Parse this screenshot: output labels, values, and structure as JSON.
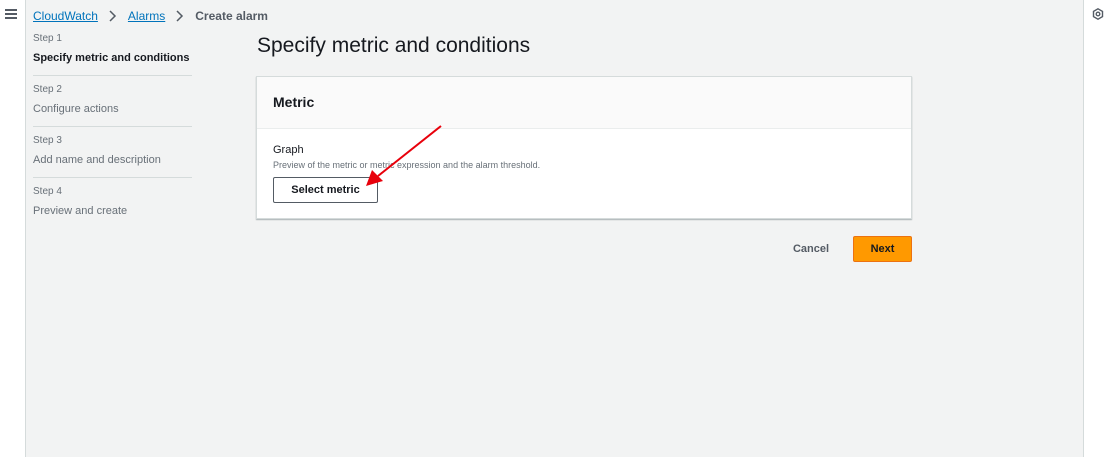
{
  "breadcrumb": {
    "items": [
      {
        "label": "CloudWatch"
      },
      {
        "label": "Alarms"
      }
    ],
    "current": "Create alarm"
  },
  "steps": [
    {
      "num": "Step 1",
      "title": "Specify metric and conditions",
      "active": true
    },
    {
      "num": "Step 2",
      "title": "Configure actions",
      "active": false
    },
    {
      "num": "Step 3",
      "title": "Add name and description",
      "active": false
    },
    {
      "num": "Step 4",
      "title": "Preview and create",
      "active": false
    }
  ],
  "page": {
    "title": "Specify metric and conditions"
  },
  "metric_card": {
    "title": "Metric",
    "graph_label": "Graph",
    "graph_description": "Preview of the metric or metric expression and the alarm threshold.",
    "select_metric_label": "Select metric"
  },
  "actions": {
    "cancel_label": "Cancel",
    "next_label": "Next"
  },
  "icons": {
    "menu": "hamburger-menu-icon",
    "settings": "settings-gear-icon",
    "separator": "chevron-right-icon"
  },
  "colors": {
    "link": "#0073bb",
    "primary_button": "#ff9900",
    "annotation_arrow": "#e8000b"
  }
}
